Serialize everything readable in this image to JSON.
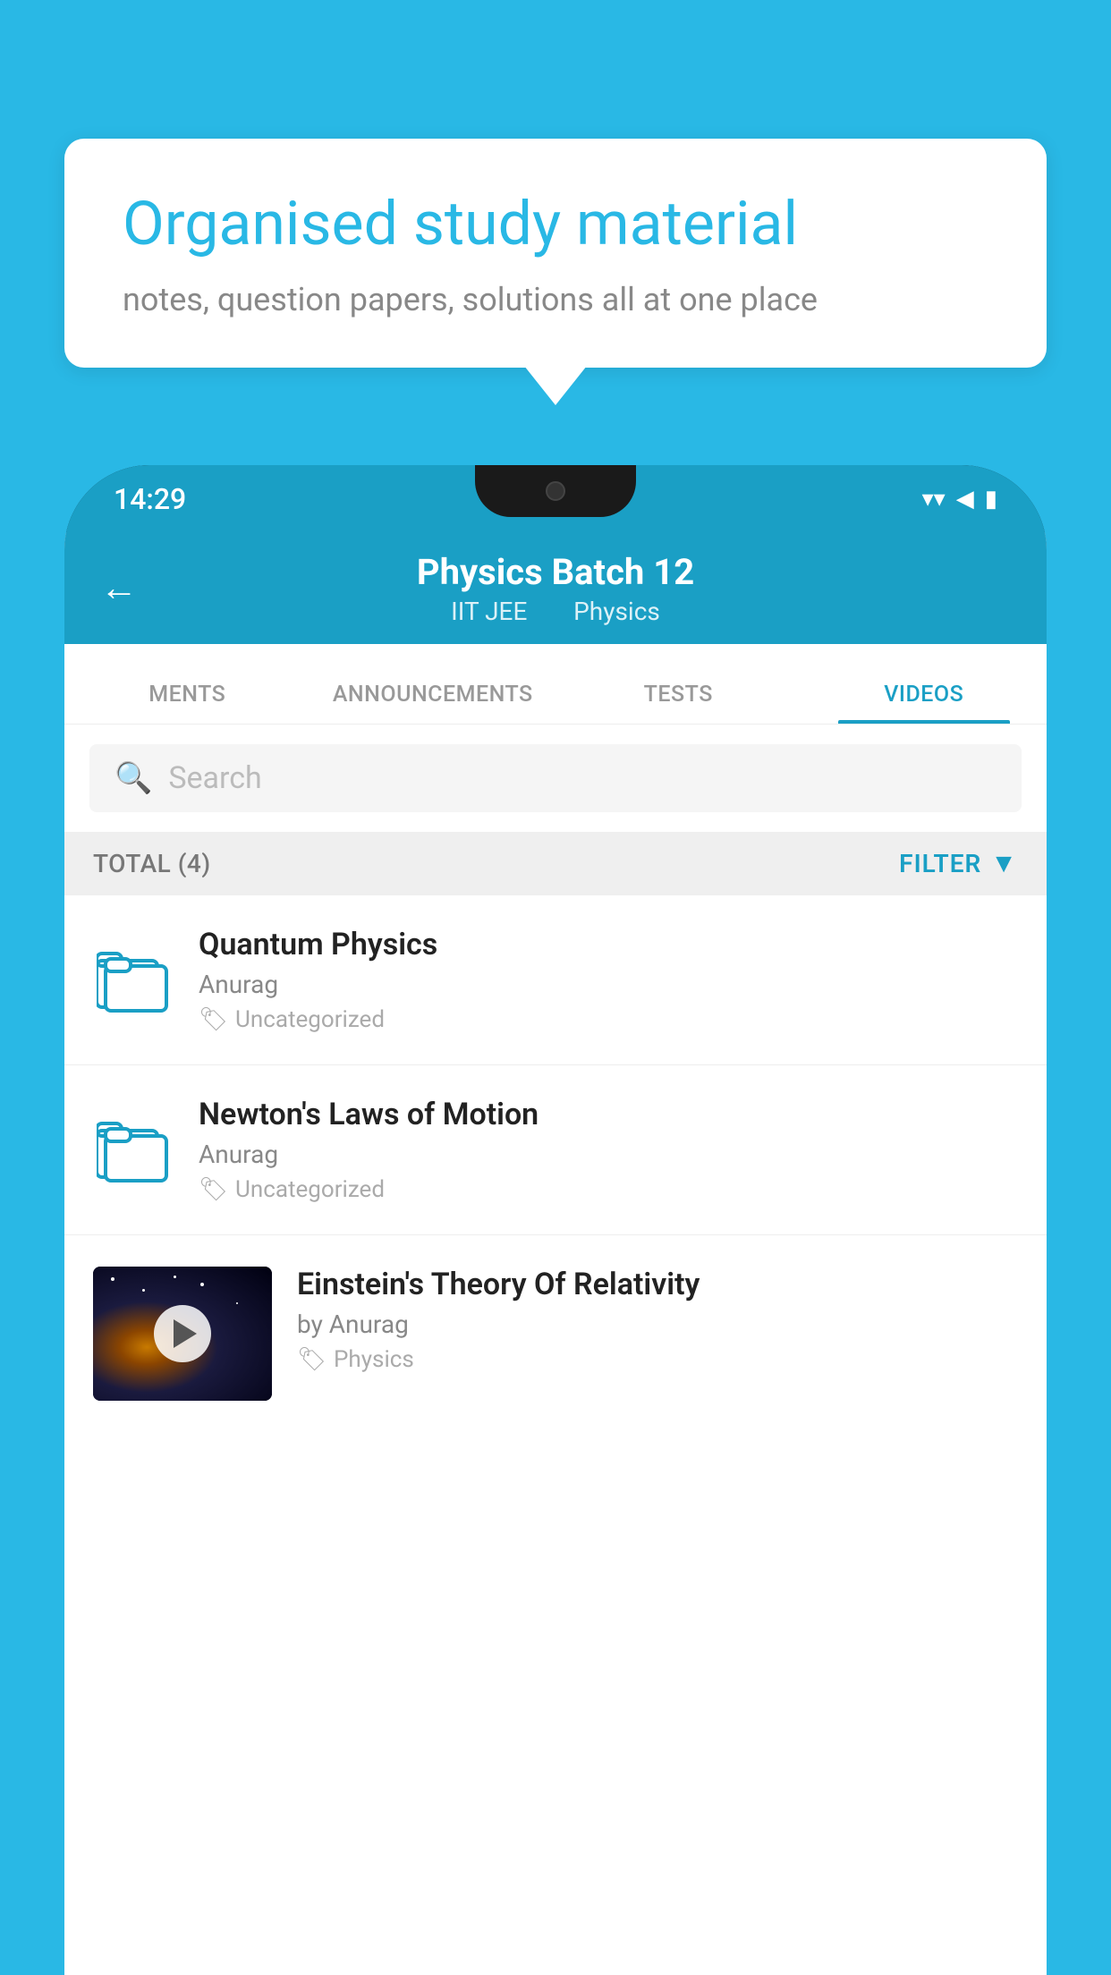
{
  "background_color": "#29b8e5",
  "bubble": {
    "title": "Organised study material",
    "subtitle": "notes, question papers, solutions all at one place"
  },
  "phone": {
    "status_bar": {
      "time": "14:29",
      "wifi": "▾",
      "signal": "▲",
      "battery": "▮"
    },
    "app_bar": {
      "back_label": "←",
      "title": "Physics Batch 12",
      "subtitle_part1": "IIT JEE",
      "subtitle_part2": "Physics"
    },
    "tabs": [
      {
        "label": "MENTS",
        "active": false
      },
      {
        "label": "ANNOUNCEMENTS",
        "active": false
      },
      {
        "label": "TESTS",
        "active": false
      },
      {
        "label": "VIDEOS",
        "active": true
      }
    ],
    "search_placeholder": "Search",
    "filter_bar": {
      "total_label": "TOTAL (4)",
      "filter_label": "FILTER"
    },
    "videos": [
      {
        "title": "Quantum Physics",
        "author": "Anurag",
        "tag": "Uncategorized",
        "type": "folder"
      },
      {
        "title": "Newton's Laws of Motion",
        "author": "Anurag",
        "tag": "Uncategorized",
        "type": "folder"
      },
      {
        "title": "Einstein's Theory Of Relativity",
        "author": "by Anurag",
        "tag": "Physics",
        "type": "video"
      }
    ]
  }
}
